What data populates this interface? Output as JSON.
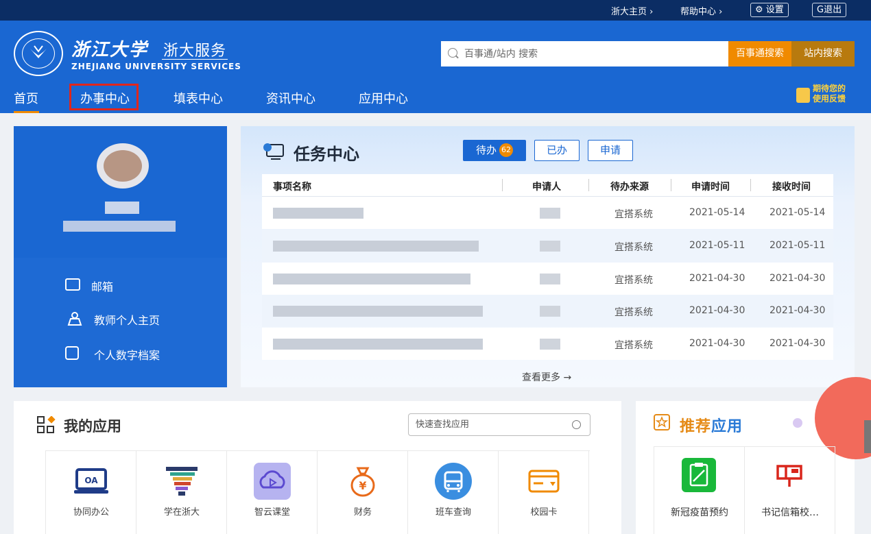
{
  "topbar": {
    "zju_home": "浙大主页",
    "help_center": "帮助中心",
    "settings": "设置",
    "logout": "退出"
  },
  "header": {
    "logo_cn": "浙江大学",
    "logo_service": "浙大服务",
    "logo_en": "ZHEJIANG UNIVERSITY SERVICES",
    "search_placeholder": "百事通/站内 搜索",
    "btn_baishitong": "百事通搜索",
    "btn_site_search": "站内搜索",
    "feedback_line1": "期待您的",
    "feedback_line2": "使用反馈"
  },
  "nav": {
    "items": [
      "首页",
      "办事中心",
      "填表中心",
      "资讯中心",
      "应用中心"
    ],
    "active": "首页",
    "highlighted": "办事中心"
  },
  "profile": {
    "links": [
      "邮箱",
      "教师个人主页",
      "个人数字档案"
    ]
  },
  "task": {
    "title": "任务中心",
    "tabs": {
      "pending": "待办",
      "pending_count": "62",
      "done": "已办",
      "apply": "申请"
    },
    "columns": [
      "事项名称",
      "申请人",
      "待办来源",
      "申请时间",
      "接收时间"
    ],
    "rows": [
      {
        "source": "宜搭系统",
        "apply_time": "2021-05-14",
        "receive_time": "2021-05-14"
      },
      {
        "source": "宜搭系统",
        "apply_time": "2021-05-11",
        "receive_time": "2021-05-11"
      },
      {
        "source": "宜搭系统",
        "apply_time": "2021-04-30",
        "receive_time": "2021-04-30"
      },
      {
        "source": "宜搭系统",
        "apply_time": "2021-04-30",
        "receive_time": "2021-04-30"
      },
      {
        "source": "宜搭系统",
        "apply_time": "2021-04-30",
        "receive_time": "2021-04-30"
      }
    ],
    "more": "查看更多 →"
  },
  "my_apps": {
    "title": "我的应用",
    "search_placeholder": "快速查找应用",
    "apps": [
      "协同办公",
      "学在浙大",
      "智云课堂",
      "财务",
      "班车查询",
      "校园卡"
    ]
  },
  "recommend": {
    "title_a": "推荐",
    "title_b": "应用",
    "apps": [
      "新冠疫苗预约",
      "书记信箱校…"
    ]
  },
  "colors": {
    "primary": "#1a67d2",
    "topbar": "#0b2d64",
    "orange": "#f08a00",
    "highlight_box": "#e0261b"
  }
}
